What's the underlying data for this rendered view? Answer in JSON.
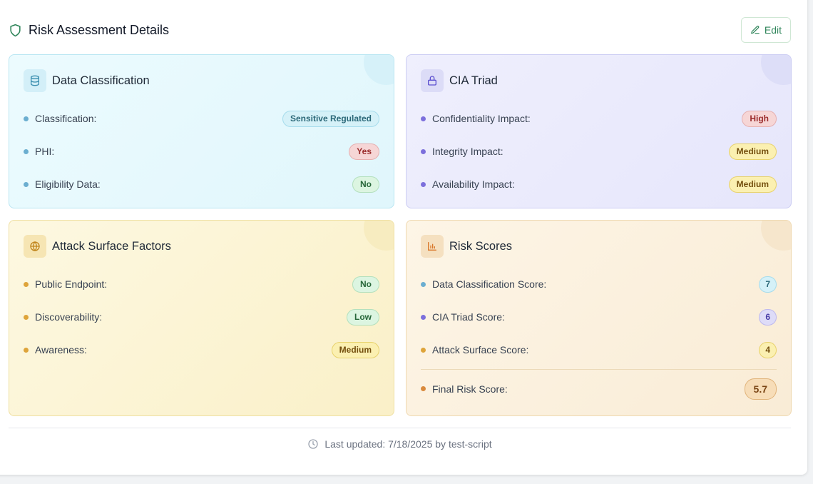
{
  "header": {
    "title": "Risk Assessment Details",
    "edit_label": "Edit"
  },
  "data_classification": {
    "title": "Data Classification",
    "rows": [
      {
        "label": "Classification:",
        "value": "Sensitive Regulated"
      },
      {
        "label": "PHI:",
        "value": "Yes"
      },
      {
        "label": "Eligibility Data:",
        "value": "No"
      }
    ]
  },
  "cia_triad": {
    "title": "CIA Triad",
    "rows": [
      {
        "label": "Confidentiality Impact:",
        "value": "High"
      },
      {
        "label": "Integrity Impact:",
        "value": "Medium"
      },
      {
        "label": "Availability Impact:",
        "value": "Medium"
      }
    ]
  },
  "attack_surface": {
    "title": "Attack Surface Factors",
    "rows": [
      {
        "label": "Public Endpoint:",
        "value": "No"
      },
      {
        "label": "Discoverability:",
        "value": "Low"
      },
      {
        "label": "Awareness:",
        "value": "Medium"
      }
    ]
  },
  "risk_scores": {
    "title": "Risk Scores",
    "rows": [
      {
        "label": "Data Classification Score:",
        "value": "7"
      },
      {
        "label": "CIA Triad Score:",
        "value": "6"
      },
      {
        "label": "Attack Surface Score:",
        "value": "4"
      }
    ],
    "final": {
      "label": "Final Risk Score:",
      "value": "5.7"
    }
  },
  "footer": {
    "text": "Last updated: 7/18/2025 by test-script"
  },
  "icons": {
    "title": "shield-icon",
    "edit": "pencil-icon",
    "data_classification": "database-icon",
    "cia_triad": "lock-icon",
    "attack_surface": "globe-icon",
    "risk_scores": "bar-chart-icon",
    "footer": "clock-icon"
  },
  "colors": {
    "accent_green": "#2f855a",
    "data_card": "#e0f6fc",
    "cia_card": "#e6e6fb",
    "attack_card": "#faf0c8",
    "score_card": "#f9ecd6"
  }
}
